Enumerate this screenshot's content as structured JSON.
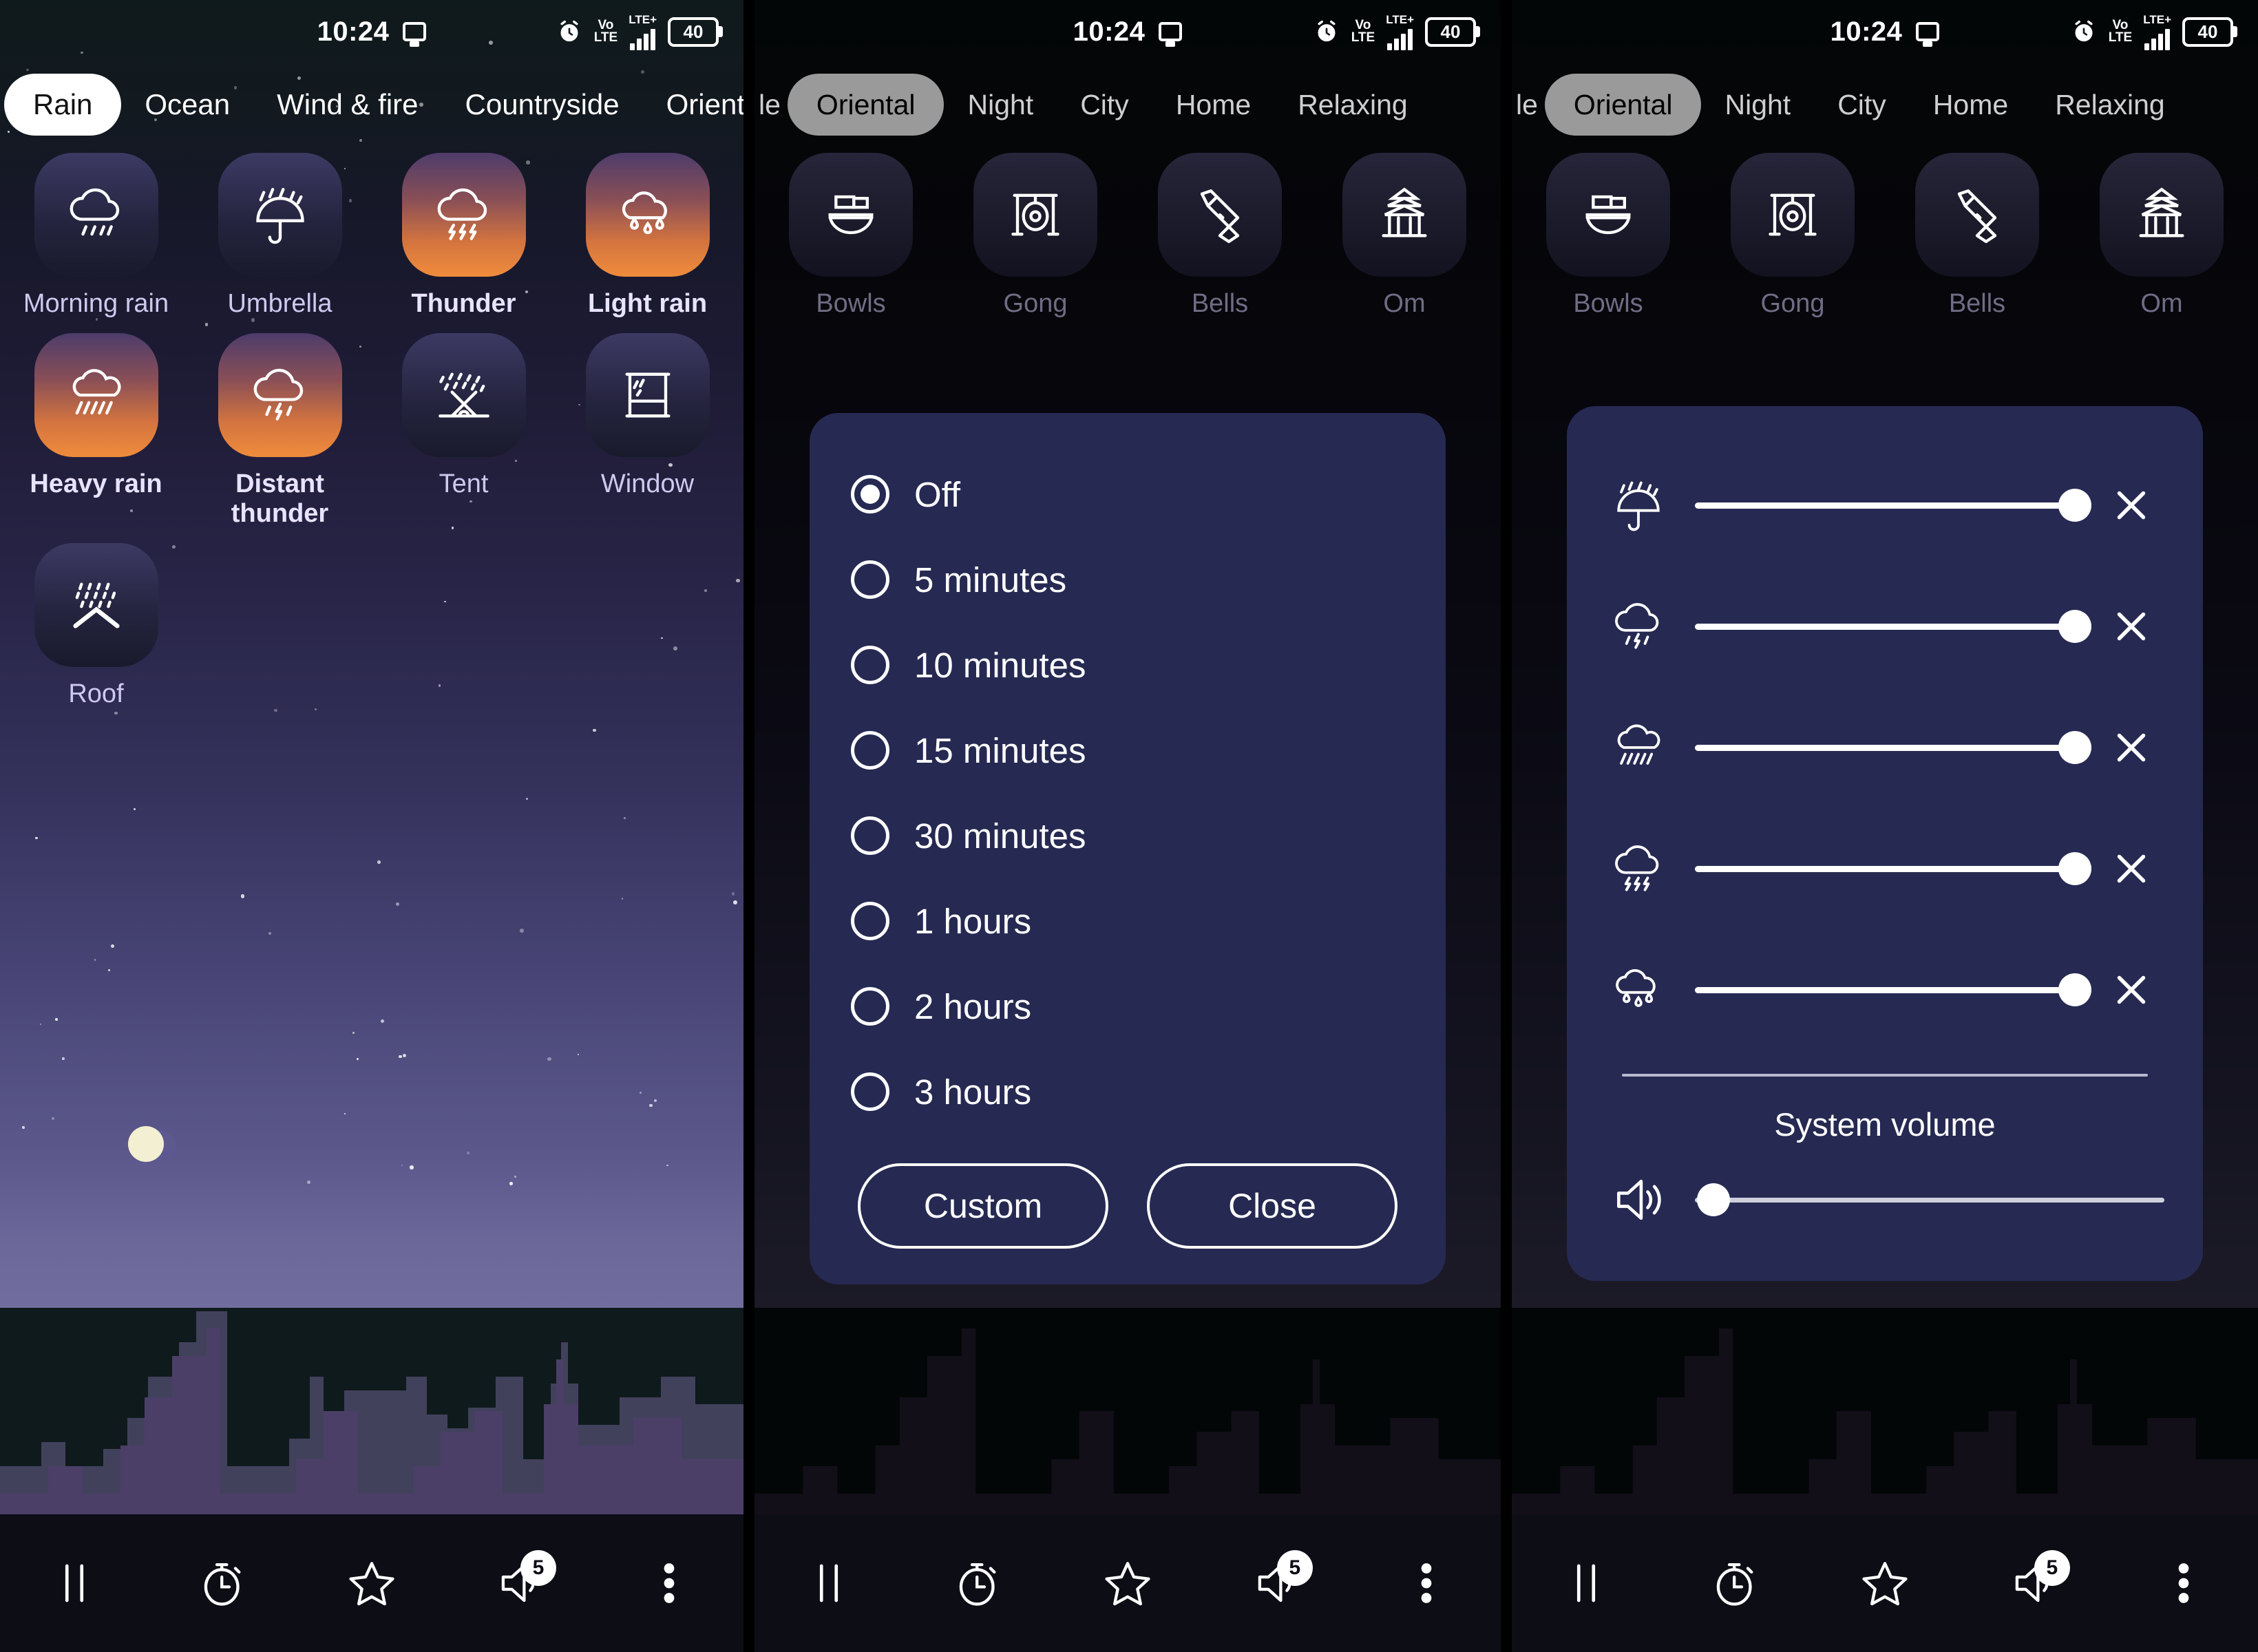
{
  "status_bar": {
    "time": "10:24",
    "cast_icon": "cast-screen-icon",
    "alarm_icon": "alarm-clock-icon",
    "volte_line1": "Vo",
    "volte_line2": "LTE",
    "network_label": "LTE+",
    "signal_icon": "signal-bars-icon",
    "battery_level": "40"
  },
  "panel_left": {
    "tabs": [
      {
        "label": "Rain",
        "active": true
      },
      {
        "label": "Ocean",
        "active": false
      },
      {
        "label": "Wind & fire",
        "active": false
      },
      {
        "label": "Countryside",
        "active": false
      },
      {
        "label": "Oriental",
        "active": false
      }
    ],
    "sounds": [
      {
        "label": "Morning rain",
        "icon": "cloud-rain-icon",
        "active": false
      },
      {
        "label": "Umbrella",
        "icon": "umbrella-rain-icon",
        "active": false
      },
      {
        "label": "Thunder",
        "icon": "cloud-lightning-icon",
        "active": true
      },
      {
        "label": "Light rain",
        "icon": "cloud-drizzle-icon",
        "active": true
      },
      {
        "label": "Heavy rain",
        "icon": "cloud-heavy-rain-icon",
        "active": true
      },
      {
        "label": "Distant thunder",
        "icon": "cloud-distant-thunder-icon",
        "active": true
      },
      {
        "label": "Tent",
        "icon": "tent-rain-icon",
        "active": false
      },
      {
        "label": "Window",
        "icon": "window-rain-icon",
        "active": false
      },
      {
        "label": "Roof",
        "icon": "roof-rain-icon",
        "active": false
      }
    ]
  },
  "panel_mid": {
    "tabs": [
      {
        "label": "le",
        "active": false,
        "partial": true
      },
      {
        "label": "Oriental",
        "active": true
      },
      {
        "label": "Night",
        "active": false
      },
      {
        "label": "City",
        "active": false
      },
      {
        "label": "Home",
        "active": false
      },
      {
        "label": "Relaxing",
        "active": false
      }
    ],
    "sounds": [
      {
        "label": "Bowls",
        "icon": "singing-bowls-icon"
      },
      {
        "label": "Gong",
        "icon": "gong-icon"
      },
      {
        "label": "Bells",
        "icon": "hand-bells-icon"
      },
      {
        "label": "Om",
        "icon": "pagoda-icon"
      }
    ],
    "timer_dialog": {
      "options": [
        {
          "label": "Off",
          "selected": true
        },
        {
          "label": "5 minutes",
          "selected": false
        },
        {
          "label": "10 minutes",
          "selected": false
        },
        {
          "label": "15 minutes",
          "selected": false
        },
        {
          "label": "30 minutes",
          "selected": false
        },
        {
          "label": "1 hours",
          "selected": false
        },
        {
          "label": "2 hours",
          "selected": false
        },
        {
          "label": "3 hours",
          "selected": false
        }
      ],
      "custom_label": "Custom",
      "close_label": "Close"
    }
  },
  "panel_right": {
    "tabs": [
      {
        "label": "le",
        "active": false,
        "partial": true
      },
      {
        "label": "Oriental",
        "active": true
      },
      {
        "label": "Night",
        "active": false
      },
      {
        "label": "City",
        "active": false
      },
      {
        "label": "Home",
        "active": false
      },
      {
        "label": "Relaxing",
        "active": false
      }
    ],
    "sounds": [
      {
        "label": "Bowls",
        "icon": "singing-bowls-icon"
      },
      {
        "label": "Gong",
        "icon": "gong-icon"
      },
      {
        "label": "Bells",
        "icon": "hand-bells-icon"
      },
      {
        "label": "Om",
        "icon": "pagoda-icon"
      }
    ],
    "mixer": {
      "tracks": [
        {
          "icon": "umbrella-rain-icon",
          "value": 100
        },
        {
          "icon": "cloud-distant-thunder-icon",
          "value": 100
        },
        {
          "icon": "cloud-heavy-rain-icon",
          "value": 100
        },
        {
          "icon": "cloud-lightning-icon",
          "value": 100
        },
        {
          "icon": "cloud-drizzle-icon",
          "value": 100
        }
      ],
      "remove_icon": "close-x-icon",
      "system_volume_label": "System volume",
      "system_volume_icon": "speaker-waves-icon",
      "system_volume_value": 4
    }
  },
  "bottom_nav": {
    "items": [
      {
        "icon": "pause-icon",
        "name": "pause-button"
      },
      {
        "icon": "timer-icon",
        "name": "timer-button"
      },
      {
        "icon": "star-icon",
        "name": "favorites-button"
      },
      {
        "icon": "volume-icon",
        "name": "volume-button",
        "badge": "5"
      },
      {
        "icon": "more-vertical-icon",
        "name": "overflow-menu-button"
      }
    ]
  },
  "colors": {
    "accent_orange": "#ef8c3c",
    "tile_idle": "#25243f",
    "card_bg": "#262a52",
    "nav_bg": "#0d0d16",
    "label": "#cdc9ef"
  }
}
